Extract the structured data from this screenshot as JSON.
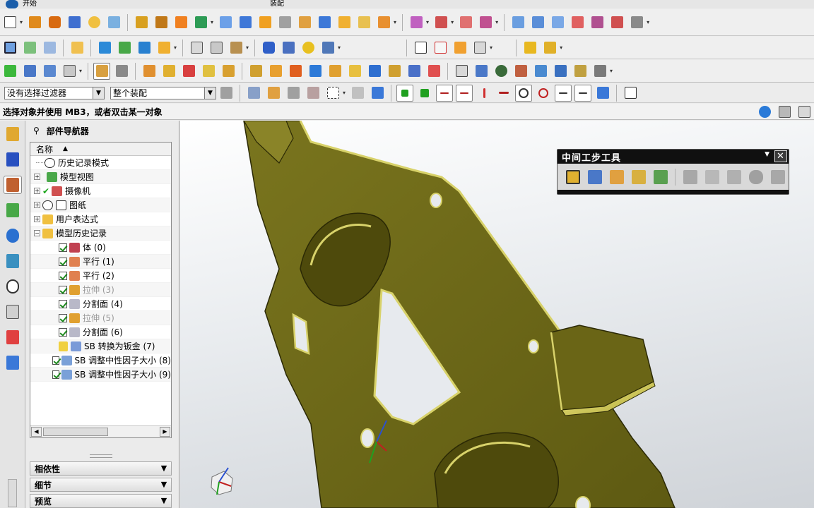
{
  "top_strip": {
    "label_1": "开始",
    "label_2": "装配"
  },
  "filter": {
    "selection_filter": "没有选择过滤器",
    "assembly_scope": "整个装配"
  },
  "status_bar": {
    "prompt": "选择对象并使用 MB3，或者双击某一对象"
  },
  "part_navigator": {
    "title": "部件导航器",
    "column_header": "名称",
    "nodes": [
      {
        "label": "历史记录模式",
        "state": "normal"
      },
      {
        "label": "模型视图",
        "state": "normal"
      },
      {
        "label": "摄像机",
        "state": "normal"
      },
      {
        "label": "图纸",
        "state": "normal"
      },
      {
        "label": "用户表达式",
        "state": "normal"
      },
      {
        "label": "模型历史记录",
        "state": "normal"
      },
      {
        "label": "体 (0)",
        "state": "normal"
      },
      {
        "label": "平行 (1)",
        "state": "normal"
      },
      {
        "label": "平行 (2)",
        "state": "normal"
      },
      {
        "label": "拉伸 (3)",
        "state": "suppressed"
      },
      {
        "label": "分割面 (4)",
        "state": "normal"
      },
      {
        "label": "拉伸 (5)",
        "state": "suppressed"
      },
      {
        "label": "分割面 (6)",
        "state": "normal"
      },
      {
        "label": "SB 转换为钣金 (7)",
        "state": "normal"
      },
      {
        "label": "SB 调整中性因子大小 (8)",
        "state": "normal"
      },
      {
        "label": "SB 调整中性因子大小 (9)",
        "state": "normal"
      }
    ],
    "sections": {
      "dependencies": "相依性",
      "details": "细节",
      "preview": "预览"
    }
  },
  "floating_toolbar": {
    "title": "中间工步工具"
  },
  "colors": {
    "part_face": "#6e6a18",
    "part_edge": "#2b2905",
    "accent": "#2a5db0",
    "viewport_bg": "#e6e9ec"
  }
}
